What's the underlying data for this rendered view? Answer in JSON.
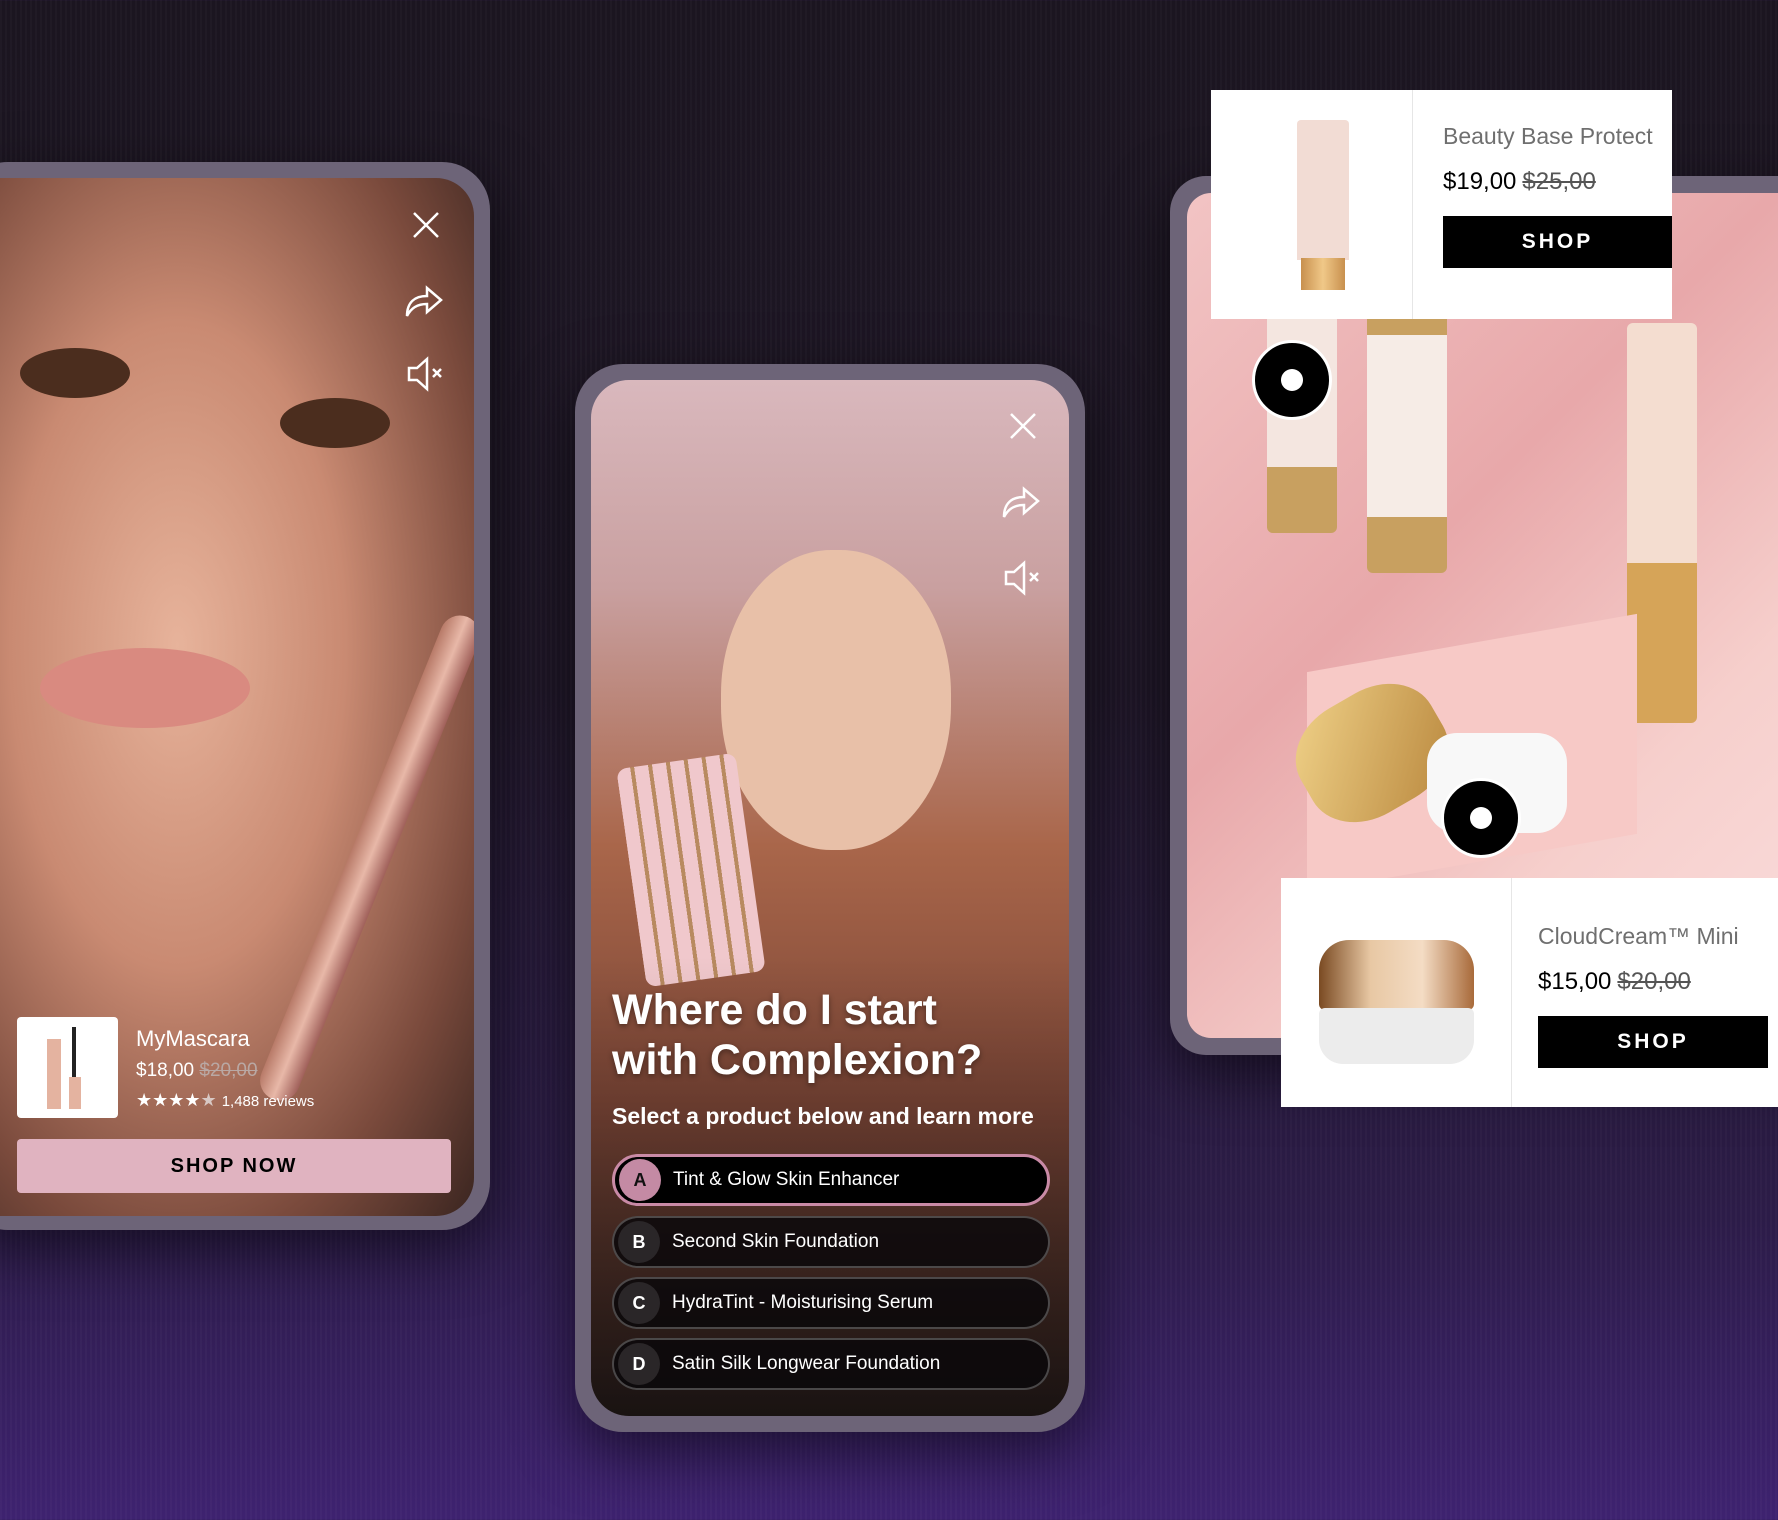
{
  "left_story": {
    "product_name": "MyMascara",
    "price": "$18,00",
    "old_price": "$20,00",
    "rating": 4.5,
    "stars": "★★★★",
    "half_star": "★",
    "reviews": "1,488 reviews",
    "cta": "SHOP NOW",
    "icons": [
      "close-icon",
      "share-icon",
      "mute-icon"
    ]
  },
  "quiz_story": {
    "title_line1": "Where do I start",
    "title_line2": "with Complexion?",
    "subtitle": "Select a product below and learn more",
    "options": [
      {
        "letter": "A",
        "label": "Tint & Glow Skin Enhancer",
        "selected": true
      },
      {
        "letter": "B",
        "label": "Second Skin Foundation"
      },
      {
        "letter": "C",
        "label": "HydraTint - Moisturising Serum"
      },
      {
        "letter": "D",
        "label": "Satin Silk Longwear Foundation"
      }
    ]
  },
  "shoppable": {
    "cards": [
      {
        "name": "Beauty Base Protect",
        "price": "$19,00",
        "old_price": "$25,00",
        "cta": "SHOP"
      },
      {
        "name": "CloudCream™ Mini",
        "price": "$15,00",
        "old_price": "$20,00",
        "cta": "SHOP"
      }
    ]
  },
  "colors": {
    "accent_pink": "#e0b3c0",
    "selected_border": "#c98aa6"
  }
}
